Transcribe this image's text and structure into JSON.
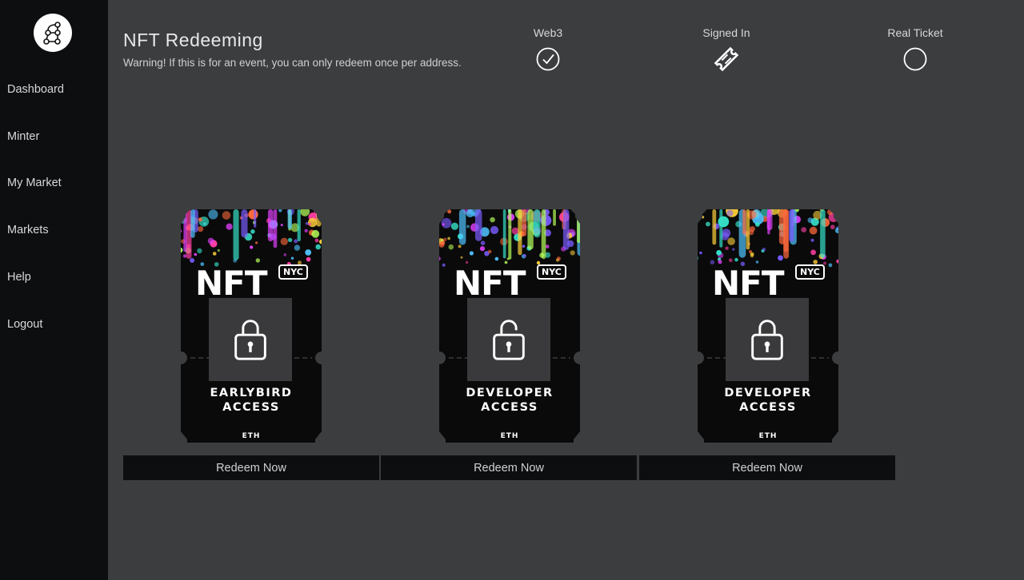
{
  "sidebar": {
    "logo_icon": "graph-nodes-icon",
    "items": [
      {
        "label": "Dashboard"
      },
      {
        "label": "Minter"
      },
      {
        "label": "My Market"
      },
      {
        "label": "Markets"
      },
      {
        "label": "Help"
      },
      {
        "label": "Logout"
      }
    ]
  },
  "header": {
    "title": "NFT Redeeming",
    "warning": "Warning! If this is for an event, you can only redeem once per address."
  },
  "status": [
    {
      "label": "Web3",
      "icon": "check-circle-icon"
    },
    {
      "label": "Signed In",
      "icon": "ticket-icon"
    },
    {
      "label": "Real Ticket",
      "icon": "empty-circle-icon"
    }
  ],
  "tickets": [
    {
      "brand": "NFT",
      "badge": "NYC",
      "line1": "EARLYBIRD",
      "line2": "ACCESS",
      "currency": "ETH",
      "lock_state": "locked",
      "button": "Redeem Now"
    },
    {
      "brand": "NFT",
      "badge": "NYC",
      "line1": "DEVELOPER",
      "line2": "ACCESS",
      "currency": "ETH",
      "lock_state": "unlocked",
      "button": "Redeem Now"
    },
    {
      "brand": "NFT",
      "badge": "NYC",
      "line1": "DEVELOPER",
      "line2": "ACCESS",
      "currency": "ETH",
      "lock_state": "locked",
      "button": "Redeem Now"
    }
  ],
  "colors": {
    "background": "#3c3d3f",
    "sidebar": "#0d0e10",
    "button": "#0d0e10",
    "ticket": "#0a0a0a"
  }
}
